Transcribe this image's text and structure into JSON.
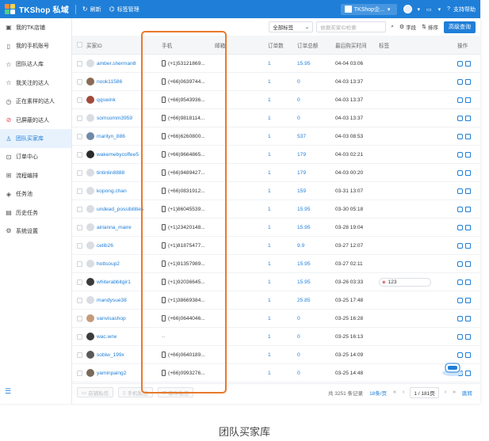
{
  "app": {
    "title": "TKShop 私域"
  },
  "topbar": {
    "refresh_label": "刷新",
    "tag_manage_label": "标签管理",
    "shop_label": "TKShop企...",
    "support_label": "支持帮助"
  },
  "sidebar": {
    "items": [
      {
        "label": "我的TK店铺",
        "icon": "shop-icon"
      },
      {
        "label": "我的手机账号",
        "icon": "phone-icon"
      },
      {
        "label": "团队达人库",
        "icon": "star-icon"
      },
      {
        "label": "我关注的达人",
        "icon": "star-outline-icon"
      },
      {
        "label": "正在素样的达人",
        "icon": "clock-icon"
      },
      {
        "label": "已屏蔽的达人",
        "icon": "block-icon"
      },
      {
        "label": "团队买家库",
        "icon": "user-icon",
        "active": true
      },
      {
        "label": "订单中心",
        "icon": "cart-icon"
      },
      {
        "label": "流程编排",
        "icon": "flow-icon"
      },
      {
        "label": "任务池",
        "icon": "task-icon"
      },
      {
        "label": "历史任务",
        "icon": "history-icon"
      },
      {
        "label": "系统设置",
        "icon": "gear-icon"
      }
    ]
  },
  "toolbar": {
    "tag_filter": "全部标签",
    "search_placeholder": "依据买家ID检索",
    "field_label": "字段",
    "sort_label": "排序",
    "advanced_label": "高级查询"
  },
  "table": {
    "columns": [
      "买家ID",
      "手机",
      "邮箱",
      "订单数",
      "订单总额",
      "最后购买时间",
      "标签",
      "操作"
    ],
    "rows": [
      {
        "id": "amber.sherman8",
        "phone": "(+1)53121869...",
        "orders": "1",
        "total": "15.95",
        "last": "04-04 03:06",
        "tag": ""
      },
      {
        "id": "nook11586",
        "phone": "(+66)0639744...",
        "orders": "1",
        "total": "0",
        "last": "04-03 13:37",
        "tag": ""
      },
      {
        "id": "qqswink",
        "phone": "(+66)9543936...",
        "orders": "1",
        "total": "0",
        "last": "04-03 13:37",
        "tag": ""
      },
      {
        "id": "somsomm3959",
        "phone": "(+66)9818114...",
        "orders": "1",
        "total": "0",
        "last": "04-03 13:37",
        "tag": ""
      },
      {
        "id": "marilyn_886",
        "phone": "(+66)6260800...",
        "orders": "1",
        "total": "537",
        "last": "04-03 08:53",
        "tag": ""
      },
      {
        "id": "wakemebycoffee5",
        "phone": "(+66)9664865...",
        "orders": "1",
        "total": "179",
        "last": "04-03 02:21",
        "tag": ""
      },
      {
        "id": "tintinlin8888",
        "phone": "(+66)9489427...",
        "orders": "1",
        "total": "179",
        "last": "04-03 00:20",
        "tag": ""
      },
      {
        "id": "kopong.chan",
        "phone": "(+66)0831912...",
        "orders": "1",
        "total": "159",
        "last": "03-31 13:07",
        "tag": ""
      },
      {
        "id": "undead_possibilities",
        "phone": "(+1)86045539...",
        "orders": "1",
        "total": "15.95",
        "last": "03-30 05:18",
        "tag": ""
      },
      {
        "id": "airianna_maire",
        "phone": "(+1)23420148...",
        "orders": "1",
        "total": "15.95",
        "last": "03-28 19:04",
        "tag": ""
      },
      {
        "id": "celib26",
        "phone": "(+1)81875477...",
        "orders": "1",
        "total": "9.9",
        "last": "03-27 12:07",
        "tag": ""
      },
      {
        "id": "hottsoup2",
        "phone": "(+1)91357989...",
        "orders": "1",
        "total": "15.95",
        "last": "03-27 02:11",
        "tag": ""
      },
      {
        "id": "whiterabbitgir1",
        "phone": "(+1)92036645...",
        "orders": "1",
        "total": "15.95",
        "last": "03-26 03:33",
        "tag": "123"
      },
      {
        "id": "mandysue38",
        "phone": "(+1)38669384...",
        "orders": "1",
        "total": "25.85",
        "last": "03-25 17:48",
        "tag": ""
      },
      {
        "id": "vanvisashop",
        "phone": "(+66)0644046...",
        "orders": "1",
        "total": "0",
        "last": "03-25 16:28",
        "tag": ""
      },
      {
        "id": "wac.wrw",
        "phone": "--",
        "orders": "1",
        "total": "0",
        "last": "03-25 16:13",
        "tag": ""
      },
      {
        "id": "sobiw_199x",
        "phone": "(+66)0640189...",
        "orders": "1",
        "total": "0",
        "last": "03-25 14:09",
        "tag": ""
      },
      {
        "id": "yaminpaing2",
        "phone": "(+66)0993276...",
        "orders": "1",
        "total": "0",
        "last": "03-25 14:48",
        "tag": ""
      }
    ]
  },
  "footer": {
    "btn1": "店铺私信",
    "btn2": "手机私信",
    "btn3": "邮件私信",
    "total_text": "共 3251 条记录",
    "page_size": "18条/页",
    "page_display": "1 / 181页",
    "jump_label": "跳转"
  },
  "caption": "团队买家库",
  "colors": {
    "primary": "#1f7fd8",
    "highlight": "#e8792b"
  }
}
